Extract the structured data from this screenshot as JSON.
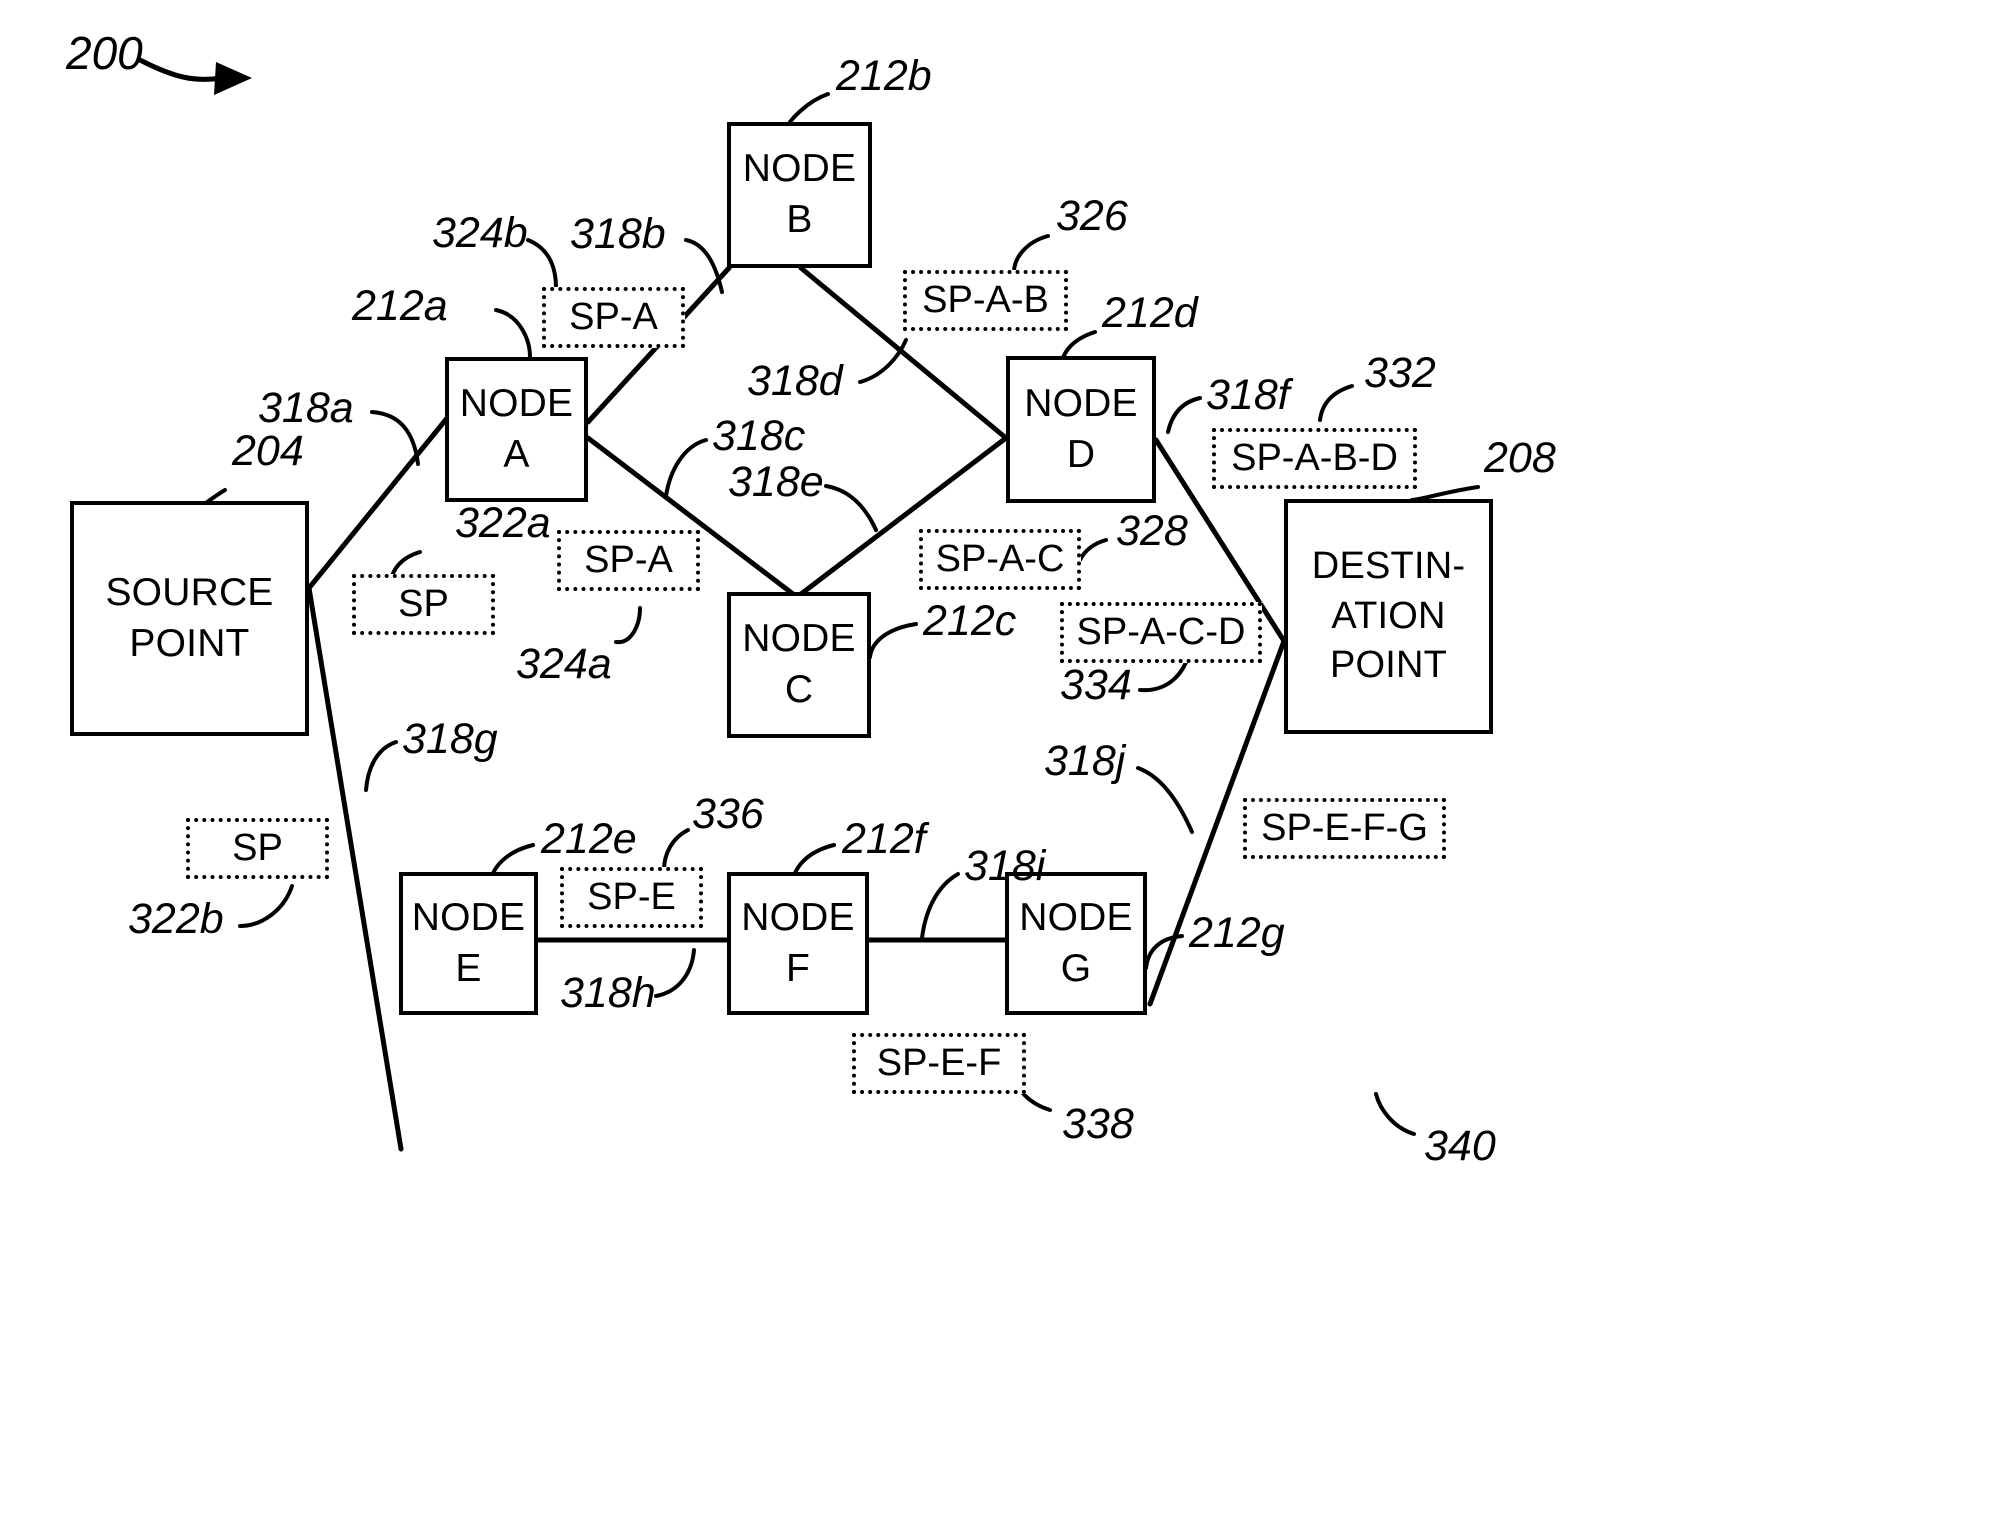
{
  "figure": {
    "figure_number": "200"
  },
  "nodes": [
    {
      "id": "source",
      "lines": [
        "SOURCE",
        "POINT"
      ],
      "ref": "204"
    },
    {
      "id": "node-a",
      "lines": [
        "NODE",
        "A"
      ],
      "ref": "212a"
    },
    {
      "id": "node-b",
      "lines": [
        "NODE",
        "B"
      ],
      "ref": "212b"
    },
    {
      "id": "node-c",
      "lines": [
        "NODE",
        "C"
      ],
      "ref": "212c"
    },
    {
      "id": "node-d",
      "lines": [
        "NODE",
        "D"
      ],
      "ref": "212d"
    },
    {
      "id": "node-e",
      "lines": [
        "NODE",
        "E"
      ],
      "ref": "212e"
    },
    {
      "id": "node-f",
      "lines": [
        "NODE",
        "F"
      ],
      "ref": "212f"
    },
    {
      "id": "node-g",
      "lines": [
        "NODE",
        "G"
      ],
      "ref": "212g"
    },
    {
      "id": "destination",
      "lines": [
        "DESTIN-",
        "ATION",
        "POINT"
      ],
      "ref": "208"
    }
  ],
  "sp_labels": [
    {
      "id": "sp-322a",
      "text": "SP",
      "ref": "322a"
    },
    {
      "id": "sp-322b",
      "text": "SP",
      "ref": "322b"
    },
    {
      "id": "sp-324a",
      "text": "SP-A",
      "ref": "324a"
    },
    {
      "id": "sp-324b",
      "text": "SP-A",
      "ref": "324b"
    },
    {
      "id": "sp-326",
      "text": "SP-A-B",
      "ref": "326"
    },
    {
      "id": "sp-328",
      "text": "SP-A-C",
      "ref": "328"
    },
    {
      "id": "sp-332",
      "text": "SP-A-B-D",
      "ref": "332"
    },
    {
      "id": "sp-334",
      "text": "SP-A-C-D",
      "ref": "334"
    },
    {
      "id": "sp-336",
      "text": "SP-E",
      "ref": "336"
    },
    {
      "id": "sp-338",
      "text": "SP-E-F",
      "ref": "338"
    },
    {
      "id": "sp-340",
      "text": "SP-E-F-G",
      "ref": "340"
    }
  ],
  "links": [
    {
      "id": "318a",
      "ref": "318a",
      "from": "source",
      "to": "node-a"
    },
    {
      "id": "318b",
      "ref": "318b",
      "from": "node-a",
      "to": "node-b"
    },
    {
      "id": "318c",
      "ref": "318c",
      "from": "node-a",
      "to": "node-c"
    },
    {
      "id": "318d",
      "ref": "318d",
      "from": "node-b",
      "to": "node-d"
    },
    {
      "id": "318e",
      "ref": "318e",
      "from": "node-c",
      "to": "node-d"
    },
    {
      "id": "318f",
      "ref": "318f",
      "from": "node-d",
      "to": "destination"
    },
    {
      "id": "318g",
      "ref": "318g",
      "from": "source",
      "to": "node-e"
    },
    {
      "id": "318h",
      "ref": "318h",
      "from": "node-e",
      "to": "node-f"
    },
    {
      "id": "318i",
      "ref": "318i",
      "from": "node-f",
      "to": "node-g"
    },
    {
      "id": "318j",
      "ref": "318j",
      "from": "node-g",
      "to": "destination"
    }
  ],
  "labels": {
    "fig200": "200",
    "r204": "204",
    "r208": "208",
    "r212a": "212a",
    "r212b": "212b",
    "r212c": "212c",
    "r212d": "212d",
    "r212e": "212e",
    "r212f": "212f",
    "r212g": "212g",
    "r318a": "318a",
    "r318b": "318b",
    "r318c": "318c",
    "r318d": "318d",
    "r318e": "318e",
    "r318f": "318f",
    "r318g": "318g",
    "r318h": "318h",
    "r318i": "318i",
    "r318j": "318j",
    "r322a": "322a",
    "r322b": "322b",
    "r324a": "324a",
    "r324b": "324b",
    "r326": "326",
    "r328": "328",
    "r332": "332",
    "r334": "334",
    "r336": "336",
    "r338": "338",
    "r340": "340",
    "sp_322a": "SP",
    "sp_322b": "SP",
    "sp_324a": "SP-A",
    "sp_324b": "SP-A",
    "sp_326": "SP-A-B",
    "sp_328": "SP-A-C",
    "sp_332": "SP-A-B-D",
    "sp_334": "SP-A-C-D",
    "sp_336": "SP-E",
    "sp_338": "SP-E-F",
    "sp_340": "SP-E-F-G",
    "source_l1": "SOURCE",
    "source_l2": "POINT",
    "dest_l1": "DESTIN-",
    "dest_l2": "ATION",
    "dest_l3": "POINT",
    "node_word": "NODE",
    "a": "A",
    "b": "B",
    "c": "C",
    "d": "D",
    "e": "E",
    "f": "F",
    "g": "G"
  },
  "colors": {
    "ink": "#000000",
    "paper": "#ffffff"
  }
}
